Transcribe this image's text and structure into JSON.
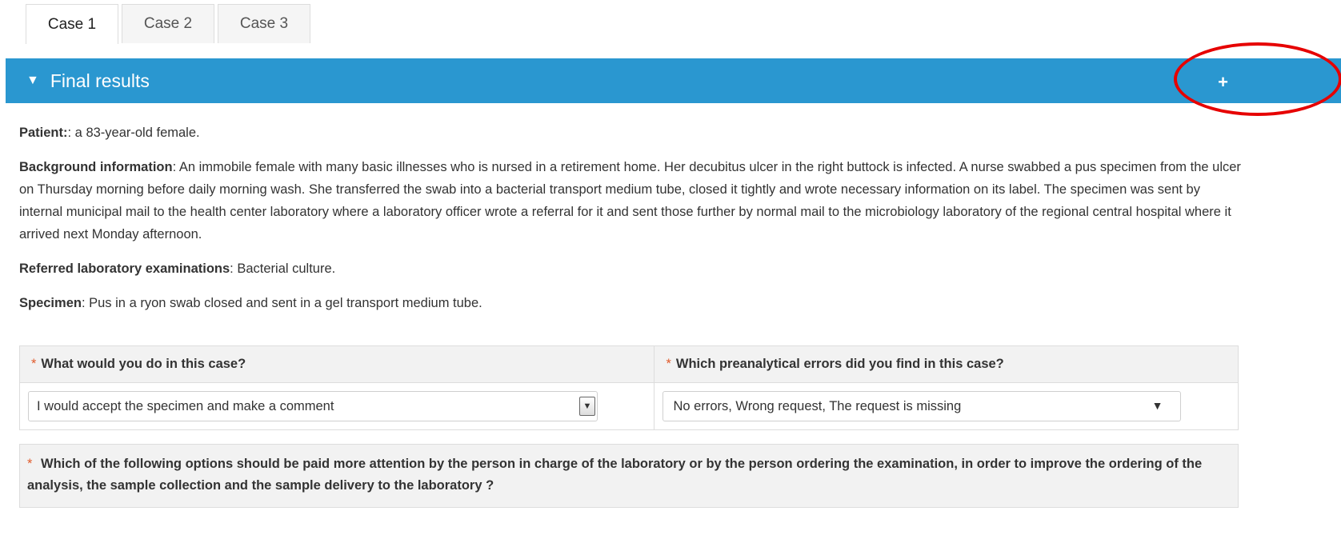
{
  "tabs": [
    {
      "label": "Case 1"
    },
    {
      "label": "Case 2"
    },
    {
      "label": "Case 3"
    }
  ],
  "panel": {
    "caret_icon": "caret-down-icon",
    "title": "Final results",
    "expand_icon": "plus-icon"
  },
  "case": {
    "patient_label": "Patient:",
    "patient_text": ": a 83-year-old female.",
    "background_label": "Background information",
    "background_text": ": An immobile female with many basic illnesses who is nursed in a retirement home. Her decubitus ulcer in the right buttock is infected. A nurse swabbed a pus specimen from the ulcer on Thursday morning before daily morning wash. She transferred the swab into a bacterial transport medium tube, closed it tightly and wrote necessary information on its label. The specimen was sent by internal municipal mail to the health center laboratory where a laboratory officer wrote a referral for it and sent those further by normal mail to the microbiology laboratory of the regional central hospital where it arrived next Monday afternoon.",
    "referred_label": "Referred laboratory examinations",
    "referred_text": ": Bacterial culture.",
    "specimen_label": "Specimen",
    "specimen_text": ": Pus in a ryon swab closed and sent in a gel transport medium tube."
  },
  "questions": {
    "required_mark": "*",
    "q1": "What would you do in this case?",
    "q1_value": "I would accept the specimen and make a comment",
    "q2": "Which preanalytical errors did you find in this case?",
    "q2_value": "No errors, Wrong request, The request is missing",
    "q3": "Which of the following options should be paid more attention by the person in charge of the laboratory or by the person ordering the examination, in order to improve the ordering of the analysis, the sample collection and the sample delivery to the laboratory ?"
  },
  "colors": {
    "header_bg": "#2a97d0",
    "highlight_circle": "#e60000",
    "required": "#e05a2b"
  }
}
